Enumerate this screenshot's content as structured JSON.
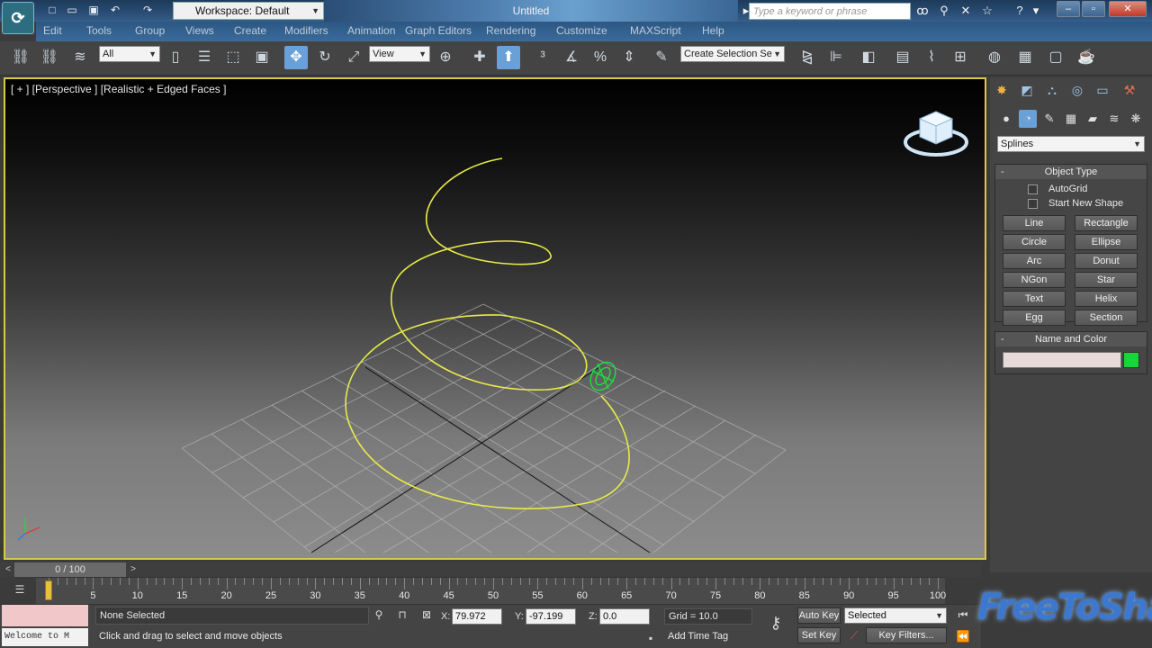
{
  "titlebar": {
    "workspace_label": "Workspace: Default",
    "document_title": "Untitled",
    "search_placeholder": "Type a keyword or phrase"
  },
  "menubar": {
    "items": [
      "Edit",
      "Tools",
      "Group",
      "Views",
      "Create",
      "Modifiers",
      "Animation",
      "Graph Editors",
      "Rendering",
      "Customize",
      "MAXScript",
      "Help"
    ]
  },
  "toolbar": {
    "selection_filter": "All",
    "reference_coord": "View",
    "named_selection": "Create Selection Se"
  },
  "viewport": {
    "label": "[ + ] [Perspective ] [Realistic + Edged Faces ]"
  },
  "command_panel": {
    "category_dropdown": "Splines",
    "object_type": {
      "title": "Object Type",
      "autogrid_label": "AutoGrid",
      "start_new_shape_label": "Start New Shape",
      "buttons": [
        "Line",
        "Rectangle",
        "Circle",
        "Ellipse",
        "Arc",
        "Donut",
        "NGon",
        "Star",
        "Text",
        "Helix",
        "Egg",
        "Section"
      ]
    },
    "name_and_color": {
      "title": "Name and Color",
      "color": "#16d63a"
    }
  },
  "timeline": {
    "frame_display": "0 / 100",
    "ruler_labels": [
      "5",
      "10",
      "15",
      "20",
      "25",
      "30",
      "35",
      "40",
      "45",
      "50",
      "55",
      "60",
      "65",
      "70",
      "75",
      "80",
      "85",
      "90",
      "95",
      "100"
    ]
  },
  "status": {
    "listener_text": "Welcome to M",
    "selection_status": "None Selected",
    "prompt": "Click and drag to select and move objects",
    "x_label": "X:",
    "x_value": "79.972",
    "y_label": "Y:",
    "y_value": "-97.199",
    "z_label": "Z:",
    "z_value": "0.0",
    "grid": "Grid = 10.0",
    "add_time_tag": "Add Time Tag",
    "auto_key": "Auto Key",
    "key_mode": "Selected",
    "set_key": "Set Key",
    "key_filters": "Key Filters..."
  },
  "watermark": "FreeToShare"
}
